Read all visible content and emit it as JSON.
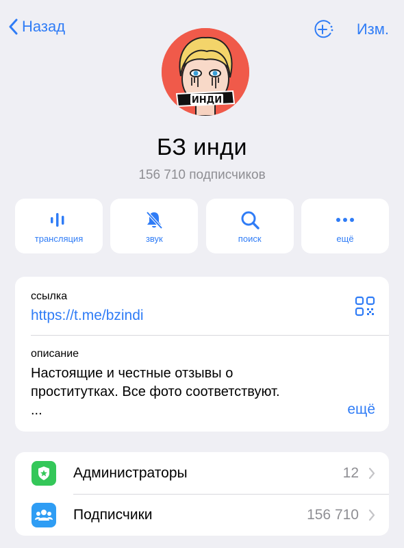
{
  "nav": {
    "back_label": "Назад",
    "edit_label": "Изм."
  },
  "channel": {
    "avatar_text": "ИНДИ",
    "title": "БЗ инди",
    "subtitle": "156 710 подписчиков"
  },
  "actions": [
    {
      "label": "трансляция",
      "icon": "broadcast-icon"
    },
    {
      "label": "звук",
      "icon": "bell-muted-icon"
    },
    {
      "label": "поиск",
      "icon": "search-icon"
    },
    {
      "label": "ещё",
      "icon": "more-icon"
    }
  ],
  "info": {
    "link_label": "ссылка",
    "link_value": "https://t.me/bzindi",
    "description_label": "описание",
    "description_line1": "Настоящие и честные отзывы о",
    "description_line2": "проститутках. Все фото соответствуют.",
    "description_line3": "...",
    "more_label": "ещё"
  },
  "list": [
    {
      "label": "Администраторы",
      "count": "12",
      "icon": "admin-shield-icon",
      "color": "#34c759"
    },
    {
      "label": "Подписчики",
      "count": "156 710",
      "icon": "subscribers-icon",
      "color": "#2f9df4"
    }
  ],
  "colors": {
    "accent": "#2f7cf6",
    "background": "#efeff4",
    "avatar_bg": "#f05a4a"
  }
}
